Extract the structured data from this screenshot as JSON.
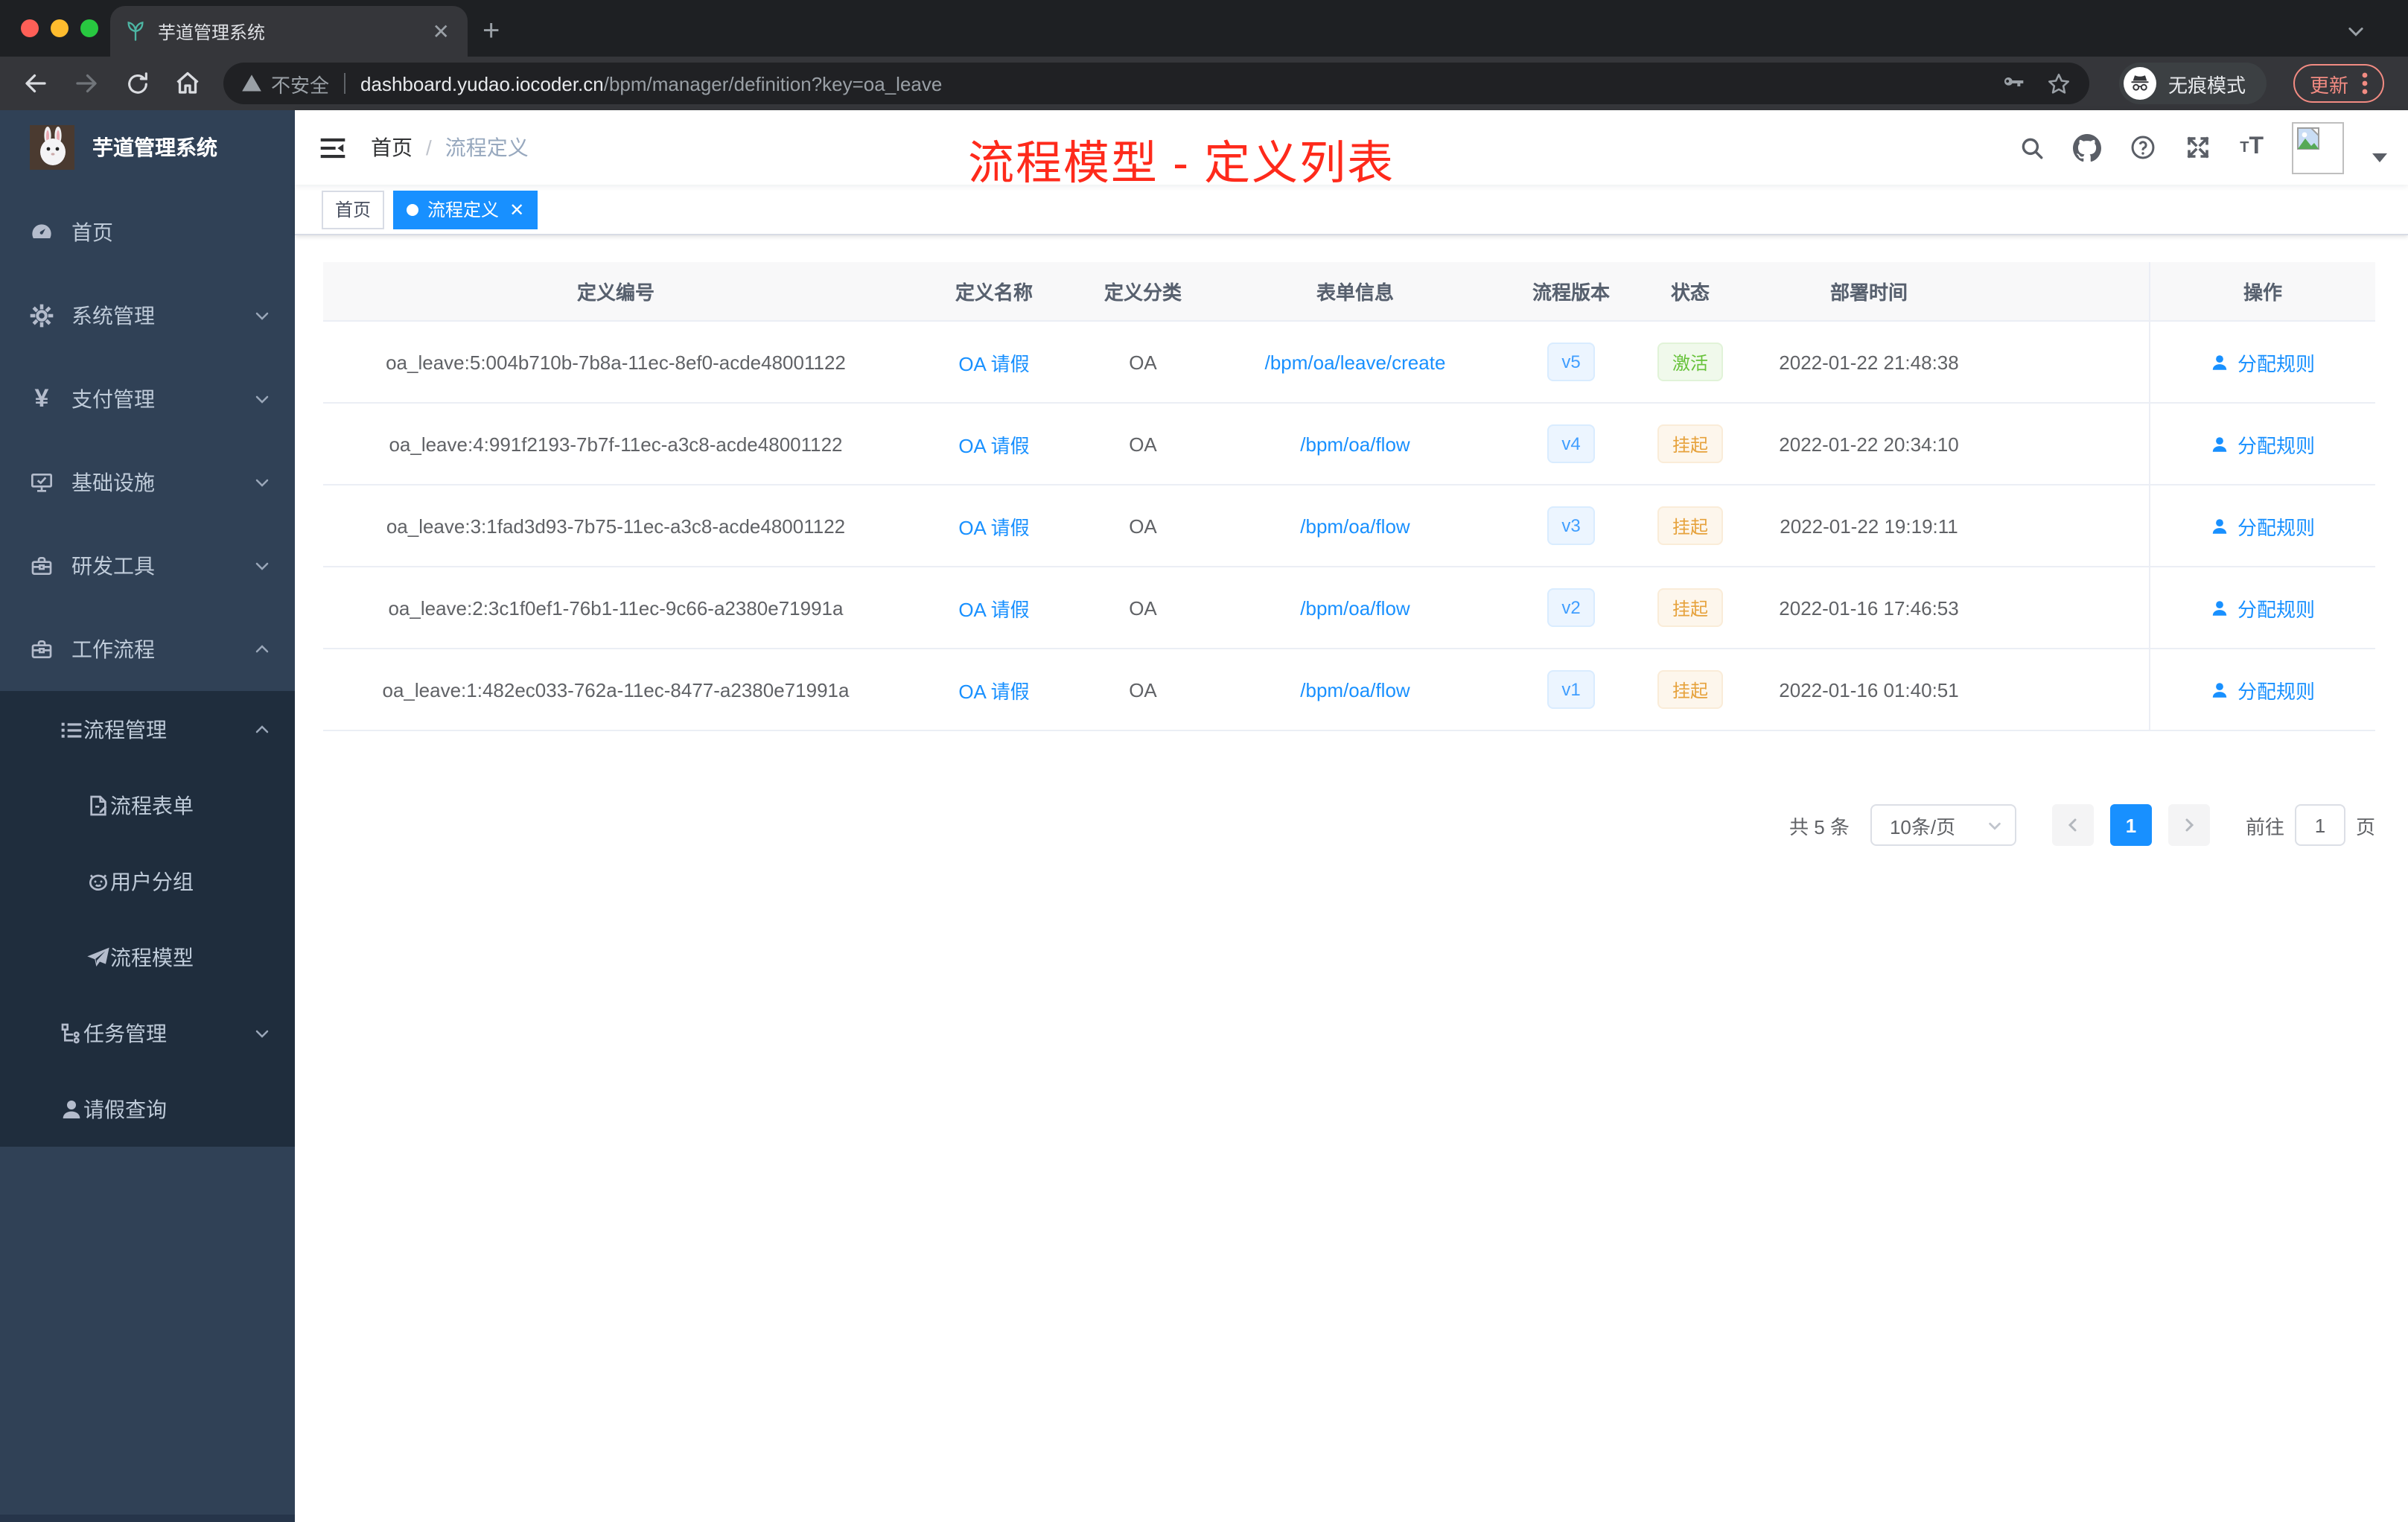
{
  "browser": {
    "tab_title": "芋道管理系统",
    "security_label": "不安全",
    "url_domain": "dashboard.yudao.iocoder.cn",
    "url_path": "/bpm/manager/definition?key=oa_leave",
    "incognito_label": "无痕模式",
    "update_label": "更新"
  },
  "annotation": {
    "title": "流程模型 - 定义列表",
    "color": "#fe2a1b"
  },
  "sidebar": {
    "app_title": "芋道管理系统",
    "items": [
      {
        "label": "首页",
        "icon": "dashboard-icon"
      },
      {
        "label": "系统管理",
        "icon": "gear-icon",
        "arrow": "down"
      },
      {
        "label": "支付管理",
        "icon": "yen-icon",
        "arrow": "down"
      },
      {
        "label": "基础设施",
        "icon": "monitor-icon",
        "arrow": "down"
      },
      {
        "label": "研发工具",
        "icon": "toolbox-icon",
        "arrow": "down"
      },
      {
        "label": "工作流程",
        "icon": "briefcase-icon",
        "arrow": "up"
      },
      {
        "label": "流程管理",
        "icon": "list-icon",
        "arrow": "up"
      },
      {
        "label": "流程表单",
        "icon": "form-icon"
      },
      {
        "label": "用户分组",
        "icon": "robot-icon"
      },
      {
        "label": "流程模型",
        "icon": "paper-plane-icon"
      },
      {
        "label": "任务管理",
        "icon": "tree-icon",
        "arrow": "down"
      },
      {
        "label": "请假查询",
        "icon": "user-icon"
      }
    ]
  },
  "navbar": {
    "breadcrumb_home": "首页",
    "breadcrumb_separator": "/",
    "breadcrumb_current": "流程定义"
  },
  "tags": {
    "home": "首页",
    "current": "流程定义"
  },
  "table": {
    "headers": [
      "定义编号",
      "定义名称",
      "定义分类",
      "表单信息",
      "流程版本",
      "状态",
      "部署时间",
      "操作"
    ],
    "rows": [
      {
        "id": "oa_leave:5:004b710b-7b8a-11ec-8ef0-acde48001122",
        "name": "OA 请假",
        "category": "OA",
        "form": "/bpm/oa/leave/create",
        "version": "v5",
        "status": "激活",
        "status_type": "success",
        "deploy_time": "2022-01-22 21:48:38",
        "action": "分配规则"
      },
      {
        "id": "oa_leave:4:991f2193-7b7f-11ec-a3c8-acde48001122",
        "name": "OA 请假",
        "category": "OA",
        "form": "/bpm/oa/flow",
        "version": "v4",
        "status": "挂起",
        "status_type": "warning",
        "deploy_time": "2022-01-22 20:34:10",
        "action": "分配规则"
      },
      {
        "id": "oa_leave:3:1fad3d93-7b75-11ec-a3c8-acde48001122",
        "name": "OA 请假",
        "category": "OA",
        "form": "/bpm/oa/flow",
        "version": "v3",
        "status": "挂起",
        "status_type": "warning",
        "deploy_time": "2022-01-22 19:19:11",
        "action": "分配规则"
      },
      {
        "id": "oa_leave:2:3c1f0ef1-76b1-11ec-9c66-a2380e71991a",
        "name": "OA 请假",
        "category": "OA",
        "form": "/bpm/oa/flow",
        "version": "v2",
        "status": "挂起",
        "status_type": "warning",
        "deploy_time": "2022-01-16 17:46:53",
        "action": "分配规则"
      },
      {
        "id": "oa_leave:1:482ec033-762a-11ec-8477-a2380e71991a",
        "name": "OA 请假",
        "category": "OA",
        "form": "/bpm/oa/flow",
        "version": "v1",
        "status": "挂起",
        "status_type": "warning",
        "deploy_time": "2022-01-16 01:40:51",
        "action": "分配规则"
      }
    ]
  },
  "pagination": {
    "total": "共 5 条",
    "page_size": "10条/页",
    "page": "1",
    "goto_label": "前往",
    "goto_value": "1",
    "page_unit": "页"
  },
  "colors": {
    "accent": "#1890ff",
    "success": "#67c23a",
    "warning": "#e6a23c",
    "sidebar_bg": "#304156",
    "submenu_bg": "#1f2d3d"
  }
}
